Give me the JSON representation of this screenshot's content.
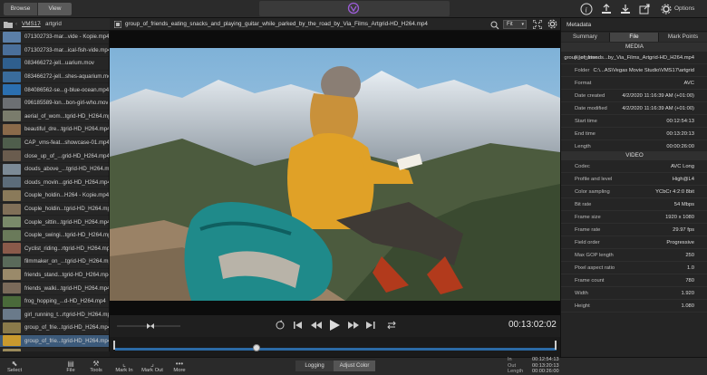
{
  "topbar": {
    "browse_label": "Browse",
    "view_label": "View",
    "options_label": "Options"
  },
  "browser": {
    "folder": "VMS17",
    "subfolder": "artgrid",
    "files": [
      {
        "name": "071302733-mar...vide - Kopie.mp4",
        "color": "#5b7fa8"
      },
      {
        "name": "071302733-mar...ical-fish-vide.mp4",
        "color": "#4a6f9a"
      },
      {
        "name": "083466272-jell...uarium.mov",
        "color": "#2f5f8e"
      },
      {
        "name": "083466272-jell...shes-aquarium.mov",
        "color": "#3a6c9c"
      },
      {
        "name": "084086562-se...g-blue-ocean.mp4",
        "color": "#2b6fb0"
      },
      {
        "name": "096185589-lon...bon-girl-who.mov",
        "color": "#6c6f73"
      },
      {
        "name": "aerial_of_wom...tgrid-HD_H264.mp4",
        "color": "#7a7c6c"
      },
      {
        "name": "beautiful_dre...tgrid-HD_H264.mp4",
        "color": "#8a6a4a"
      },
      {
        "name": "CAP_vms-feat...showcase-01.mp4",
        "color": "#4f5e4c"
      },
      {
        "name": "close_up_of_...grid-HD_H264.mp4",
        "color": "#6a5c4e"
      },
      {
        "name": "clouds_above_...tgrid-HD_H264.mp4",
        "color": "#7c8a96"
      },
      {
        "name": "clouds_movin...grid-HD_H264.mp4",
        "color": "#5c6c7a"
      },
      {
        "name": "Couple_holdin...H264 - Kopie.mp4",
        "color": "#8a7a5a"
      },
      {
        "name": "Couple_holdin...tgrid-HD_H264.mp4",
        "color": "#806f58"
      },
      {
        "name": "Couple_sittin...tgrid-HD_H264.mp4",
        "color": "#7a8a6a"
      },
      {
        "name": "Couple_swingi...tgrid-HD_H264.mp4",
        "color": "#6a7a5a"
      },
      {
        "name": "Cyclist_riding...rtgrid-HD_H264.mp4",
        "color": "#8a5a4a"
      },
      {
        "name": "filmmaker_on_...tgrid-HD_H264.mp4",
        "color": "#5a6a5a"
      },
      {
        "name": "friends_stand...tgrid-HD_H264.mp4",
        "color": "#9a8a6a"
      },
      {
        "name": "friends_walki...tgrid-HD_H264.mp4",
        "color": "#7a6a5a"
      },
      {
        "name": "frog_hopping_...d-HD_H264.mp4",
        "color": "#4a6a3a"
      },
      {
        "name": "girl_running_t...rtgrid-HD_H264.mp4",
        "color": "#6a7a8a"
      },
      {
        "name": "group_of_frie...tgrid-HD_H264.mp4",
        "color": "#8a7a4a"
      },
      {
        "name": "group_of_frie...tgrid-HD_H264.mp4",
        "color": "#c99a2e"
      },
      {
        "name": "group_of_frie...tgrid-HD_H264.mp4",
        "color": "#9a8a5a"
      }
    ],
    "selected_index": 23
  },
  "viewer": {
    "title": "group_of_friends_eating_snacks_and_playing_guitar_while_parked_by_the_road_by_Via_Films_Artgrid-HD_H264.mp4",
    "fit_label": "Fit",
    "timecode": "00:13:02:02",
    "playhead_fraction": 0.32
  },
  "bottom": {
    "select_label": "Select",
    "file_label": "File",
    "tools_label": "Tools",
    "markin_label": "Mark In",
    "markout_label": "Mark Out",
    "more_label": "More",
    "logging_label": "Logging",
    "adjust_label": "Adjust Color",
    "in_key": "In",
    "in_value": "00:12:54:13",
    "out_key": "Out",
    "out_value": "00:13:20:13",
    "length_key": "Length",
    "length_value": "00:00:26:00"
  },
  "metadata": {
    "title": "Metadata",
    "tabs": [
      "Summary",
      "File",
      "Mark Points"
    ],
    "active_tab": 1,
    "media_header": "MEDIA",
    "video_header": "VIDEO",
    "media": [
      {
        "k": "File name",
        "v": "group_of_friends...by_Via_Films_Artgrid-HD_H264.mp4"
      },
      {
        "k": "Folder",
        "v": "C:\\...AS\\Vegas Movie Studio\\VMS17\\artgrid"
      },
      {
        "k": "Format",
        "v": "AVC"
      },
      {
        "k": "Date created",
        "v": "4/2/2020 11:16:39 AM (+01:00)"
      },
      {
        "k": "Date modified",
        "v": "4/2/2020 11:16:39 AM (+01:00)"
      },
      {
        "k": "Start time",
        "v": "00:12:54:13"
      },
      {
        "k": "End time",
        "v": "00:13:20:13"
      },
      {
        "k": "Length",
        "v": "00:00:26:00"
      }
    ],
    "video": [
      {
        "k": "Codec",
        "v": "AVC Long"
      },
      {
        "k": "Profile and level",
        "v": "High@L4"
      },
      {
        "k": "Color sampling",
        "v": "YCbCr 4:2:0 8bit"
      },
      {
        "k": "Bit rate",
        "v": "54 Mbps"
      },
      {
        "k": "Frame size",
        "v": "1920 x 1080"
      },
      {
        "k": "Frame rate",
        "v": "29.97 fps"
      },
      {
        "k": "Field order",
        "v": "Progressive"
      },
      {
        "k": "Max GOP length",
        "v": "250"
      },
      {
        "k": "Pixel aspect ratio",
        "v": "1.0"
      },
      {
        "k": "Frame count",
        "v": "780"
      },
      {
        "k": "Width",
        "v": "1.920"
      },
      {
        "k": "Height",
        "v": "1.080"
      }
    ]
  }
}
